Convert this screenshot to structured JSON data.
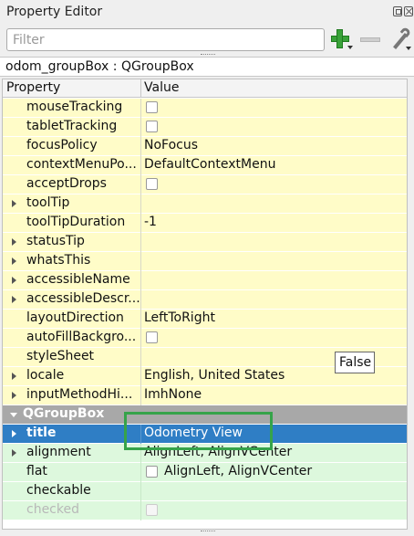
{
  "window": {
    "title": "Property Editor"
  },
  "filter": {
    "placeholder": "Filter",
    "value": ""
  },
  "toolbar": {
    "add_icon": "plus-icon",
    "remove_icon": "minus-icon",
    "configure_icon": "wrench-icon"
  },
  "object_line": "odom_groupBox : QGroupBox",
  "table": {
    "headers": {
      "property": "Property",
      "value": "Value"
    },
    "rows": [
      {
        "name": "mouseTracking",
        "value": "",
        "checkbox": true
      },
      {
        "name": "tabletTracking",
        "value": "",
        "checkbox": true
      },
      {
        "name": "focusPolicy",
        "value": "NoFocus"
      },
      {
        "name": "contextMenuPo...",
        "value": "DefaultContextMenu"
      },
      {
        "name": "acceptDrops",
        "value": "",
        "checkbox": true
      },
      {
        "name": "toolTip",
        "value": "",
        "expandable": true
      },
      {
        "name": "toolTipDuration",
        "value": "-1"
      },
      {
        "name": "statusTip",
        "value": "",
        "expandable": true
      },
      {
        "name": "whatsThis",
        "value": "",
        "expandable": true
      },
      {
        "name": "accessibleName",
        "value": "",
        "expandable": true
      },
      {
        "name": "accessibleDescr...",
        "value": "",
        "expandable": true
      },
      {
        "name": "layoutDirection",
        "value": "LeftToRight"
      },
      {
        "name": "autoFillBackgro...",
        "value": "",
        "checkbox": true
      },
      {
        "name": "styleSheet",
        "value": ""
      },
      {
        "name": "locale",
        "value": "English, United States",
        "expandable": true
      },
      {
        "name": "inputMethodHi...",
        "value": "ImhNone",
        "expandable": true
      }
    ],
    "section": {
      "name": "QGroupBox"
    },
    "group_rows": [
      {
        "name": "title",
        "value": "Odometry View",
        "selected": true,
        "expandable": true
      },
      {
        "name": "alignment",
        "value": "AlignLeft, AlignVCenter",
        "expandable": true
      },
      {
        "name": "flat",
        "value": "AlignLeft, AlignVCenter",
        "checkbox": true
      },
      {
        "name": "checkable",
        "value": ""
      },
      {
        "name": "checked",
        "value": "",
        "checkbox": true,
        "disabled": true
      }
    ]
  },
  "tooltip": {
    "text": "False"
  },
  "colors": {
    "row_yellow": "#fffcc8",
    "row_green": "#ddf8dd",
    "section_gray": "#a8a8a8",
    "selection_blue": "#2f7ec5",
    "highlight_green": "#36a34a"
  }
}
